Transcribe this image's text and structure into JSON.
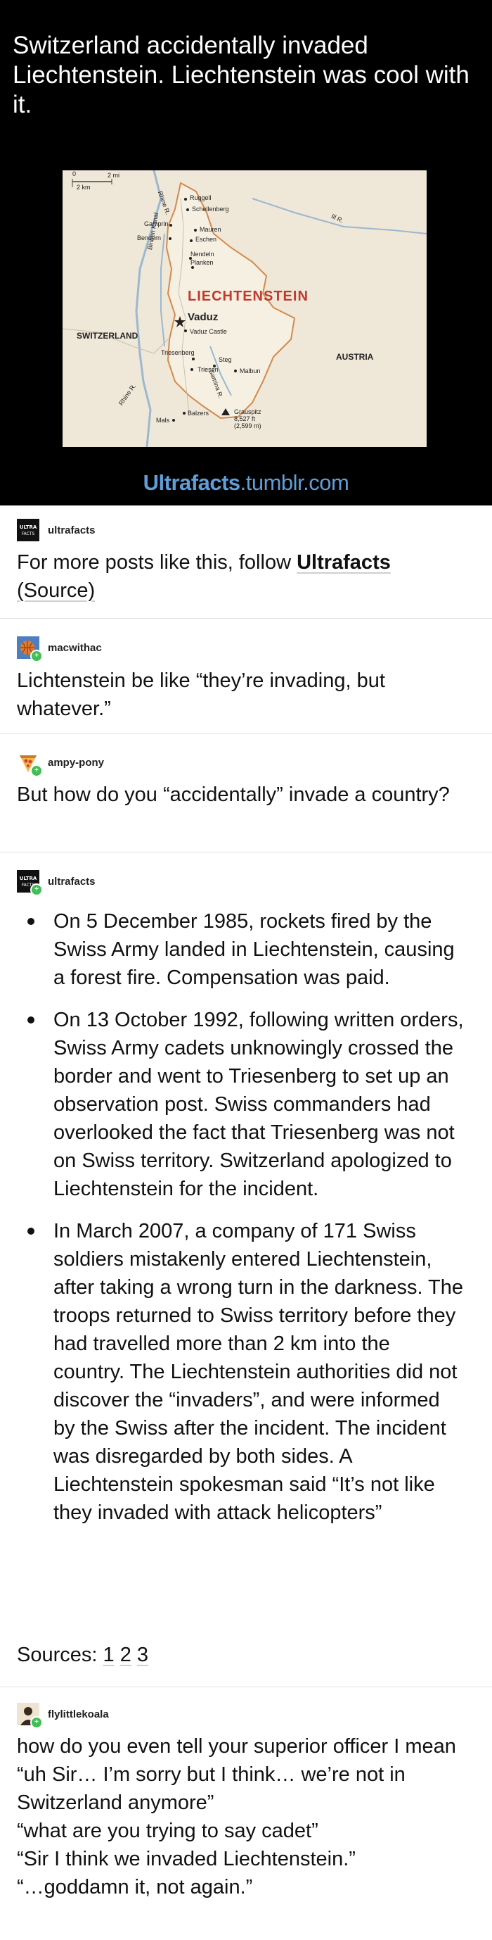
{
  "header": {
    "title": "Switzerland accidentally invaded Liechtenstein. Liechtenstein was cool with it.",
    "brand_bold": "Ultrafacts",
    "brand_rest": ".tumblr.com",
    "brand_color": "#5f9ed8"
  },
  "map": {
    "country_label": "LIECHTENSTEIN",
    "switzerland": "SWITZERLAND",
    "austria": "AUSTRIA",
    "capital": "Vaduz",
    "scale_mi": "2 mi",
    "scale_km": "2 km",
    "scale_zero": "0",
    "towns": [
      "Ruggell",
      "Schellenberg",
      "Gamprin",
      "Mauren",
      "Bendern",
      "Eschen",
      "Nendeln",
      "Planken",
      "Vaduz Castle",
      "Triesenberg",
      "Steg",
      "Triesen",
      "Malbun",
      "Balzers",
      "Mals"
    ],
    "rivers": [
      "Rhine R.",
      "Binnen Kanal",
      "Ill R.",
      "Samina R.",
      "Rhine R."
    ],
    "peak_name": "Grauspitz",
    "peak_m": "8,527 ft",
    "peak_ft": "(2,599 m)"
  },
  "posts": [
    {
      "username": "ultrafacts",
      "avatar_icon": "ultrafacts-logo-icon",
      "text_prefix": "For more posts like this, follow ",
      "text_link": "Ultrafacts",
      "text_source": "(Source)"
    },
    {
      "username": "macwithac",
      "avatar_icon": "basketball-avatar-icon",
      "text": "Lichtenstein be like “they’re invading, but whatever.”"
    },
    {
      "username": "ampy-pony",
      "avatar_icon": "pizza-avatar-icon",
      "text": "But how do you “accidentally” invade a country?"
    },
    {
      "username": "ultrafacts",
      "avatar_icon": "ultrafacts-logo-icon",
      "facts": [
        "On 5 December 1985, rockets fired by the Swiss Army landed in Liechtenstein, causing a forest fire. Compensation was paid.",
        "On 13 October 1992, following written orders, Swiss Army cadets unknowingly crossed the border and went to Triesenberg to set up an observation post. Swiss commanders had overlooked the fact that Triesenberg was not on Swiss territory. Switzerland apologized to Liechtenstein for the incident.",
        "In March 2007, a company of 171 Swiss soldiers mistakenly entered Liechtenstein, after taking a wrong turn in the darkness. The troops returned to Swiss territory before they had travelled more than 2 km into the country. The Liechtenstein authorities did not discover the “invaders”, and were informed by the Swiss after the incident. The incident was disregarded by both sides. A Liechtenstein spokesman said “It’s not like they invaded with attack helicopters”"
      ],
      "sources_label": "Sources:",
      "sources": [
        "1",
        "2",
        "3"
      ]
    },
    {
      "username": "flylittlekoala",
      "avatar_icon": "person-avatar-icon",
      "lines": [
        "how do you even tell your superior officer I mean",
        "“uh Sir… I’m sorry but I think… we’re not in Switzerland anymore”",
        "“what are you trying to say cadet”",
        "“Sir I think we invaded Liechtenstein.”",
        "“…goddamn it, not again.”"
      ]
    }
  ]
}
